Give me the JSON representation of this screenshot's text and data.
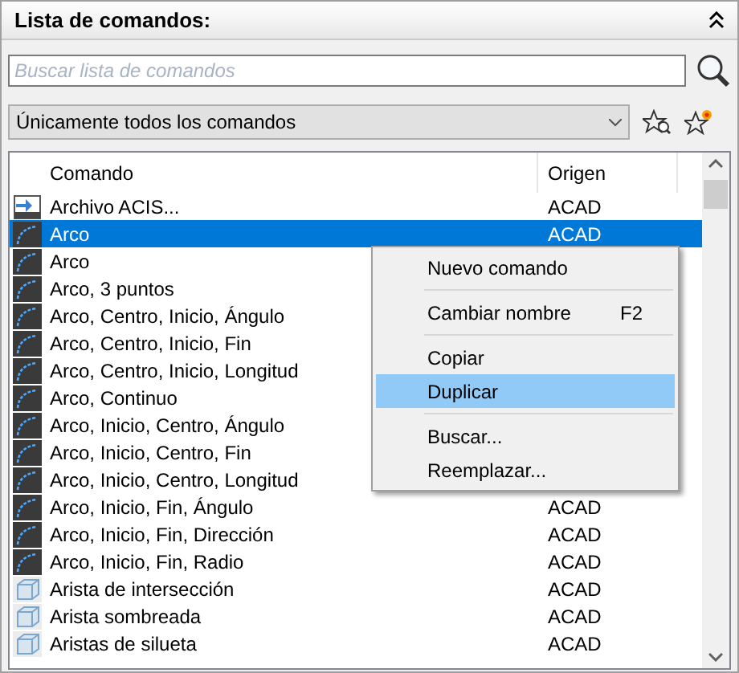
{
  "panel": {
    "title": "Lista de comandos:"
  },
  "search": {
    "placeholder": "Buscar lista de comandos"
  },
  "filter": {
    "value": "Únicamente todos los comandos"
  },
  "table": {
    "columns": [
      "Comando",
      "Origen"
    ],
    "rows": [
      {
        "kind": "file",
        "command": "Archivo ACIS...",
        "origin": "ACAD",
        "selected": false
      },
      {
        "kind": "arc",
        "command": "Arco",
        "origin": "ACAD",
        "selected": true
      },
      {
        "kind": "arc",
        "command": "Arco",
        "selected": false
      },
      {
        "kind": "arc",
        "command": "Arco, 3 puntos",
        "selected": false
      },
      {
        "kind": "arc",
        "command": "Arco, Centro, Inicio, Ángulo",
        "selected": false
      },
      {
        "kind": "arc",
        "command": "Arco, Centro, Inicio, Fin",
        "selected": false
      },
      {
        "kind": "arc",
        "command": "Arco, Centro, Inicio, Longitud",
        "selected": false
      },
      {
        "kind": "arc",
        "command": "Arco, Continuo",
        "selected": false
      },
      {
        "kind": "arc",
        "command": "Arco, Inicio, Centro, Ángulo",
        "selected": false
      },
      {
        "kind": "arc",
        "command": "Arco, Inicio, Centro, Fin",
        "selected": false
      },
      {
        "kind": "arc",
        "command": "Arco, Inicio, Centro, Longitud",
        "selected": false
      },
      {
        "kind": "arc",
        "command": "Arco, Inicio, Fin, Ángulo",
        "origin": "ACAD",
        "selected": false
      },
      {
        "kind": "arc",
        "command": "Arco, Inicio, Fin, Dirección",
        "origin": "ACAD",
        "selected": false
      },
      {
        "kind": "arc",
        "command": "Arco, Inicio, Fin, Radio",
        "origin": "ACAD",
        "selected": false
      },
      {
        "kind": "solid",
        "command": "Arista de intersección",
        "origin": "ACAD",
        "selected": false
      },
      {
        "kind": "solid",
        "command": "Arista sombreada",
        "origin": "ACAD",
        "selected": false
      },
      {
        "kind": "solid",
        "command": "Aristas de silueta",
        "origin": "ACAD",
        "selected": false
      }
    ]
  },
  "context_menu": {
    "items": [
      {
        "kind": "item",
        "label": "Nuevo comando",
        "selected": false
      },
      {
        "kind": "separator"
      },
      {
        "kind": "item",
        "label": "Cambiar nombre",
        "shortcut": "F2",
        "selected": false
      },
      {
        "kind": "separator"
      },
      {
        "kind": "item",
        "label": "Copiar",
        "selected": false
      },
      {
        "kind": "item",
        "label": "Duplicar",
        "selected": true
      },
      {
        "kind": "separator"
      },
      {
        "kind": "item",
        "label": "Buscar...",
        "selected": false
      },
      {
        "kind": "item",
        "label": "Reemplazar...",
        "selected": false
      }
    ]
  }
}
